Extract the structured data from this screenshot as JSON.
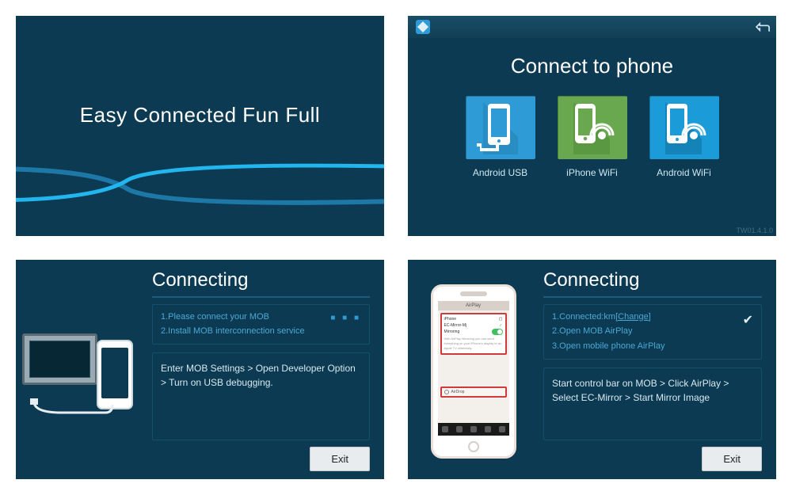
{
  "panel1": {
    "title": "Easy Connected Fun Full"
  },
  "panel2": {
    "title": "Connect to phone",
    "version": "TW01.4.1.0",
    "options": [
      {
        "label": "Android USB"
      },
      {
        "label": "iPhone WiFi"
      },
      {
        "label": "Android WiFi"
      }
    ]
  },
  "panel3": {
    "title": "Connecting",
    "steps": [
      "1.Please connect your MOB",
      "2.Install MOB interconnection service"
    ],
    "instruction": "Enter MOB Settings > Open Developer Option > Turn on USB debugging.",
    "exit": "Exit"
  },
  "panel4": {
    "title": "Connecting",
    "step1_prefix": "1.Connected:km",
    "step1_link": "[Change]",
    "steps_rest": [
      "2.Open MOB AirPlay",
      "3.Open mobile phone AirPlay"
    ],
    "instruction": "Start control bar on MOB > Click AirPlay > Select EC-Mirror > Start Mirror Image",
    "exit": "Exit",
    "iphone": {
      "header": "AirPlay",
      "row_iphone": "iPhone",
      "row_ec": "EC-Mirror-Mj",
      "row_mirror": "Mirroring",
      "airdrop": "AirDrop"
    }
  }
}
